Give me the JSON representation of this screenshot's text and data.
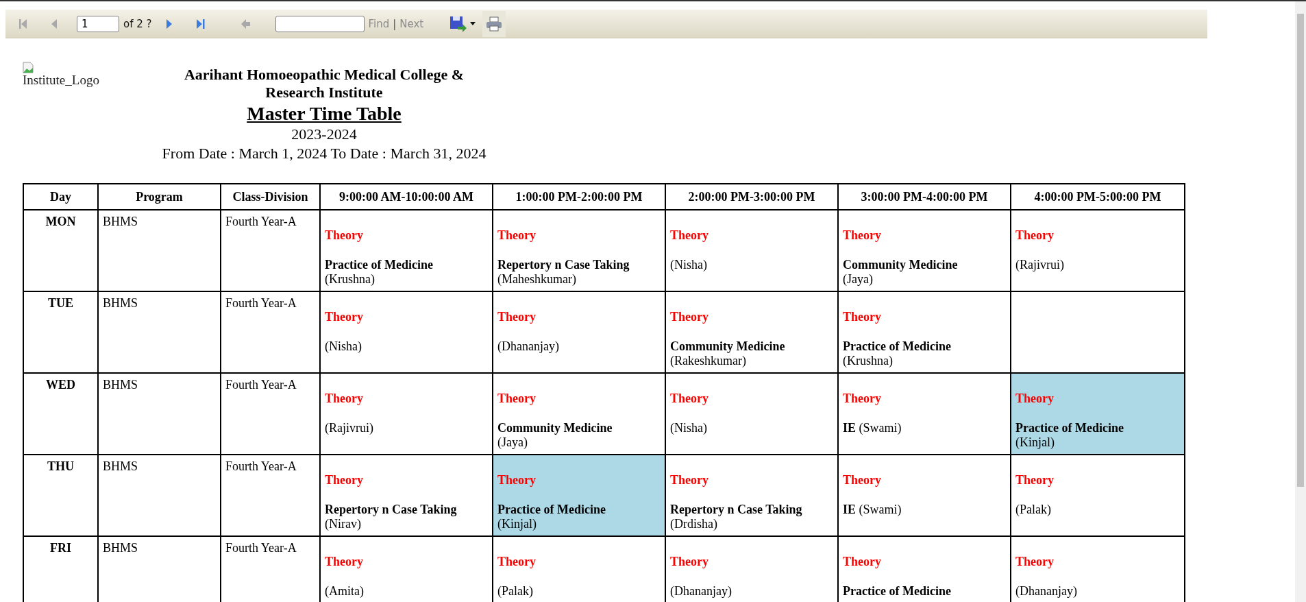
{
  "toolbar": {
    "nav_buttons": [
      {
        "kind": "first",
        "disabled": true
      },
      {
        "kind": "prev",
        "disabled": true
      }
    ],
    "page_input": {
      "value": "1"
    },
    "page_count": "of 2 ?",
    "nav_buttons_after": [
      {
        "kind": "next",
        "disabled": false
      },
      {
        "kind": "last",
        "disabled": false
      },
      {
        "kind": "back",
        "disabled": true
      }
    ],
    "find_link": "Find",
    "separator": "|",
    "next_link": "Next"
  },
  "header": {
    "logo_alt": "Institute_Logo",
    "institute": "Aarihant Homoeopathic Medical College & Research Institute",
    "title": "Master Time Table",
    "year": "2023-2024",
    "date_range": "From Date : March 1, 2024 To Date : March 31, 2024"
  },
  "table": {
    "columns": [
      "Day",
      "Program",
      "Class-Division",
      "9:00:00 AM-10:00:00 AM",
      "1:00:00 PM-2:00:00 PM",
      "2:00:00 PM-3:00:00 PM",
      "3:00:00 PM-4:00:00 PM",
      "4:00:00 PM-5:00:00 PM"
    ],
    "rows": [
      {
        "day": "MON",
        "program": "BHMS",
        "class_division": "Fourth Year-A",
        "slots": [
          {
            "type": "Theory",
            "subject": "Practice of Medicine",
            "teacher": "(Krushna)",
            "highlighted": false
          },
          {
            "type": "Theory",
            "subject": "Repertory n Case Taking",
            "teacher": "(Maheshkumar)",
            "highlighted": false
          },
          {
            "type": "Theory",
            "teacher": "(Nisha)",
            "highlighted": false
          },
          {
            "type": "Theory",
            "subject": "Community Medicine",
            "teacher": "(Jaya)",
            "highlighted": false
          },
          {
            "type": "Theory",
            "teacher": "(Rajivrui)",
            "highlighted": false
          }
        ]
      },
      {
        "day": "TUE",
        "program": "BHMS",
        "class_division": "Fourth Year-A",
        "slots": [
          {
            "type": "Theory",
            "teacher": "(Nisha)",
            "highlighted": false
          },
          {
            "type": "Theory",
            "teacher": "(Dhananjay)",
            "highlighted": false
          },
          {
            "type": "Theory",
            "subject": "Community Medicine",
            "teacher": "(Rakeshkumar)",
            "highlighted": false
          },
          {
            "type": "Theory",
            "subject": "Practice of Medicine",
            "teacher": "(Krushna)",
            "highlighted": false
          },
          {
            "highlighted": false
          }
        ]
      },
      {
        "day": "WED",
        "program": "BHMS",
        "class_division": "Fourth Year-A",
        "slots": [
          {
            "type": "Theory",
            "teacher": "(Rajivrui)",
            "highlighted": false
          },
          {
            "type": "Theory",
            "subject": "Community Medicine",
            "teacher": "(Jaya)",
            "highlighted": false
          },
          {
            "type": "Theory",
            "teacher": "(Nisha)",
            "highlighted": false
          },
          {
            "type": "Theory",
            "line": "**IE** (Swami)",
            "highlighted": false
          },
          {
            "type": "Theory",
            "subject": "Practice of Medicine",
            "teacher": "(Kinjal)",
            "highlighted": true
          }
        ]
      },
      {
        "day": "THU",
        "program": "BHMS",
        "class_division": "Fourth Year-A",
        "slots": [
          {
            "type": "Theory",
            "subject": "Repertory n Case Taking",
            "teacher": "(Nirav)",
            "highlighted": false
          },
          {
            "type": "Theory",
            "subject": "Practice of Medicine",
            "teacher": "(Kinjal)",
            "highlighted": true
          },
          {
            "type": "Theory",
            "subject": "Repertory n Case Taking",
            "teacher": "(Drdisha)",
            "highlighted": false
          },
          {
            "type": "Theory",
            "line": "**IE** (Swami)",
            "highlighted": false
          },
          {
            "type": "Theory",
            "teacher": "(Palak)",
            "highlighted": false
          }
        ]
      },
      {
        "day": "FRI",
        "program": "BHMS",
        "class_division": "Fourth Year-A",
        "slots": [
          {
            "type": "Theory",
            "teacher": "(Amita)",
            "highlighted": false
          },
          {
            "type": "Theory",
            "teacher": "(Palak)",
            "highlighted": false
          },
          {
            "type": "Theory",
            "teacher": "(Dhananjay)",
            "highlighted": false
          },
          {
            "type": "Theory",
            "subject": "Practice of Medicine",
            "highlighted": false
          },
          {
            "type": "Theory",
            "teacher": "(Dhananjay)",
            "highlighted": false
          }
        ]
      }
    ]
  }
}
